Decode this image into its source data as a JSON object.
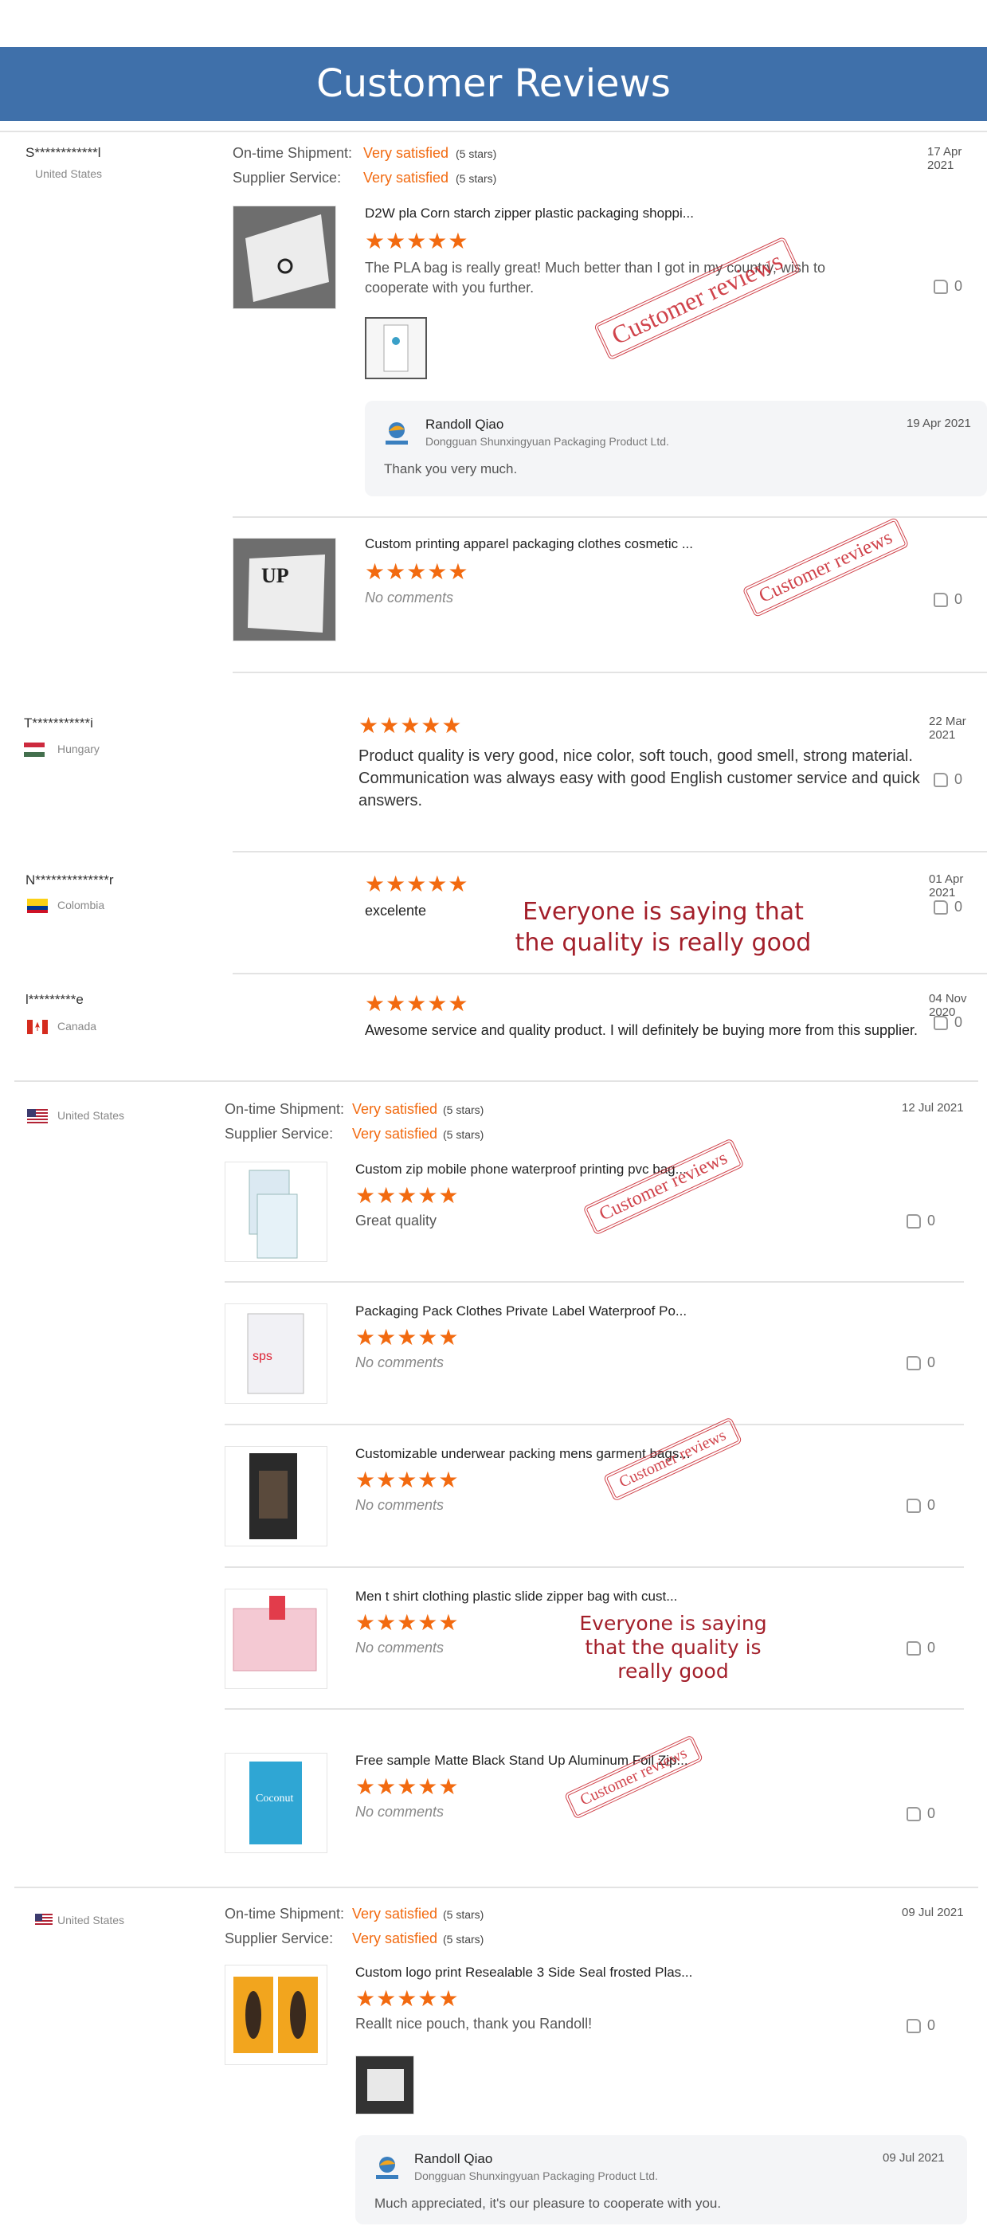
{
  "header": {
    "title": "Customer Reviews"
  },
  "labels": {
    "ontime": "On-time Shipment:",
    "supplier": "Supplier Service:",
    "satisfied": "Very satisfied",
    "five": "(5 stars)",
    "no_comments": "No comments",
    "stars": "★★★★★"
  },
  "reviews": [
    {
      "user": "S************l",
      "country": "United States",
      "date": "17 Apr 2021",
      "products": [
        {
          "title": "D2W pla Corn starch zipper plastic packaging shoppi...",
          "comment": "The PLA bag is really great! Much better than I got in my country, wish to cooperate with you further.",
          "likes": "0"
        },
        {
          "title": "Custom printing apparel packaging clothes cosmetic ...",
          "comment": "No comments",
          "likes": "0"
        }
      ],
      "reply": {
        "name": "Randoll Qiao",
        "company": "Dongguan Shunxingyuan Packaging Product Ltd.",
        "date": "19 Apr 2021",
        "text": "Thank you very much."
      }
    },
    {
      "user": "T***********i",
      "country": "Hungary",
      "date": "22 Mar 2021",
      "comment": "Product quality is very good, nice color, soft touch, good smell, strong material. Communication was always easy with good English customer service and quick answers.",
      "likes": "0"
    },
    {
      "user": "N**************r",
      "country": "Colombia",
      "date": "01 Apr 2021",
      "comment": "excelente",
      "likes": "0"
    },
    {
      "user": "l*********e",
      "country": "Canada",
      "date": "04 Nov 2020",
      "comment": "Awesome service and quality product. I will definitely be buying more from this supplier.",
      "likes": "0"
    },
    {
      "country": "United States",
      "date": "12 Jul 2021",
      "products": [
        {
          "title": "Custom zip mobile phone waterproof printing pvc bag...",
          "comment": "Great quality",
          "likes": "0"
        },
        {
          "title": "Packaging Pack Clothes Private Label Waterproof Po...",
          "comment": "No comments",
          "likes": "0"
        },
        {
          "title": "Customizable underwear packing mens garment bags...",
          "comment": "No comments",
          "likes": "0"
        },
        {
          "title": "Men t shirt clothing plastic slide zipper bag with cust...",
          "comment": "No comments",
          "likes": "0"
        },
        {
          "title": "Free sample Matte Black Stand Up Aluminum Foil Zip...",
          "comment": "No comments",
          "likes": "0"
        }
      ]
    },
    {
      "country": "United States",
      "date": "09 Jul 2021",
      "products": [
        {
          "title": "Custom logo print Resealable 3 Side Seal frosted Plas...",
          "comment": "Reallt nice pouch, thank you Randoll!",
          "likes": "0"
        }
      ],
      "reply": {
        "name": "Randoll Qiao",
        "company": "Dongguan Shunxingyuan Packaging Product Ltd.",
        "date": "09 Jul 2021",
        "text": "Much appreciated, it's our pleasure to cooperate with you."
      }
    }
  ],
  "overlays": {
    "stamp": "Customer reviews",
    "headline": "Everyone is saying that the quality is really good"
  },
  "colors": {
    "banner": "#3f70aa",
    "accent": "#f26a10",
    "stamp": "#c8232c"
  }
}
